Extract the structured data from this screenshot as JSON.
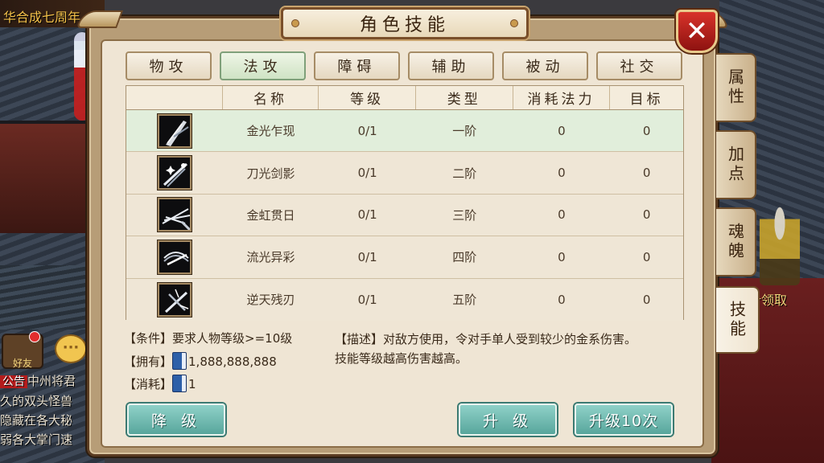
{
  "scene": {
    "banner_text": "华合成七周年",
    "right_event_text": "累计领取",
    "friend_label": "好友",
    "chat_tag": "公告",
    "chat_lines": [
      "中州将君",
      "久的双头怪兽",
      "隐藏在各大秘",
      "弱各大掌门速"
    ]
  },
  "dialog": {
    "title": "角色技能",
    "close_label": "✕"
  },
  "tabs": [
    {
      "label": "物攻",
      "active": false
    },
    {
      "label": "法攻",
      "active": true
    },
    {
      "label": "障碍",
      "active": false
    },
    {
      "label": "辅助",
      "active": false
    },
    {
      "label": "被动",
      "active": false
    },
    {
      "label": "社交",
      "active": false
    }
  ],
  "side_tabs": [
    {
      "label": "属性",
      "active": false
    },
    {
      "label": "加点",
      "active": false
    },
    {
      "label": "魂魄",
      "active": false
    },
    {
      "label": "技能",
      "active": true
    }
  ],
  "table": {
    "headers": [
      "",
      "名称",
      "等级",
      "类型",
      "消耗法力",
      "目标"
    ],
    "rows": [
      {
        "icon": "sword-flash-icon",
        "name": "金光乍现",
        "level": "0/1",
        "type": "一阶",
        "mana": "0",
        "target": "0",
        "selected": true
      },
      {
        "icon": "blade-shadow-icon",
        "name": "刀光剑影",
        "level": "0/1",
        "type": "二阶",
        "mana": "0",
        "target": "0",
        "selected": false
      },
      {
        "icon": "rainbow-sun-icon",
        "name": "金虹贯日",
        "level": "0/1",
        "type": "三阶",
        "mana": "0",
        "target": "0",
        "selected": false
      },
      {
        "icon": "flowing-light-icon",
        "name": "流光异彩",
        "level": "0/1",
        "type": "四阶",
        "mana": "0",
        "target": "0",
        "selected": false
      },
      {
        "icon": "broken-blade-icon",
        "name": "逆天残刃",
        "level": "0/1",
        "type": "五阶",
        "mana": "0",
        "target": "0",
        "selected": false
      }
    ]
  },
  "info": {
    "condition_tag": "【条件】",
    "condition_text": "要求人物等级>=10级",
    "own_tag": "【拥有】",
    "own_value": "1,888,888,888",
    "cost_tag": "【消耗】",
    "cost_value": "1",
    "desc_tag": "【描述】",
    "desc_text": "对敌方使用，令对手单人受到较少的金系伤害。",
    "desc_text2": "技能等级越高伤害越高。"
  },
  "buttons": {
    "downgrade": "降 级",
    "upgrade": "升 级",
    "upgrade10": "升级10次"
  },
  "colors": {
    "panel": "#efe5d4",
    "selected_row": "#e1eedb",
    "button": "#58a69c",
    "close": "#d8322a"
  }
}
